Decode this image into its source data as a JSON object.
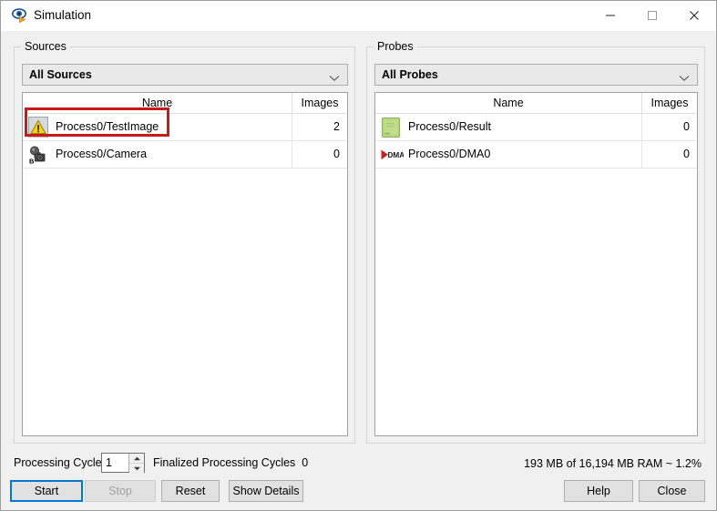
{
  "window": {
    "title": "Simulation",
    "icon": "eye-play-icon",
    "controls": {
      "minimize": "minimize-icon",
      "maximize": "maximize-icon",
      "close": "close-icon"
    }
  },
  "sources": {
    "group_label": "Sources",
    "filter_selected": "All Sources",
    "filter_options": [
      "All Sources"
    ],
    "columns": [
      "Name",
      "Images"
    ],
    "rows": [
      {
        "icon": "warning-triangle-icon",
        "name": "Process0/TestImage",
        "images": "2",
        "highlighted": true
      },
      {
        "icon": "camera-icon",
        "name": "Process0/Camera",
        "images": "0",
        "highlighted": false
      }
    ]
  },
  "probes": {
    "group_label": "Probes",
    "filter_selected": "All Probes",
    "filter_options": [
      "All Probes"
    ],
    "columns": [
      "Name",
      "Images"
    ],
    "rows": [
      {
        "icon": "green-image-icon",
        "name": "Process0/Result",
        "images": "0",
        "highlighted": false
      },
      {
        "icon": "dma-icon",
        "name": "Process0/DMA0",
        "images": "0",
        "highlighted": false
      }
    ]
  },
  "footer": {
    "processing_cycle_label": "Processing Cycle",
    "processing_cycle_value": "1",
    "finalized_label": "Finalized Processing Cycles",
    "finalized_value": "0",
    "ram_status": "193 MB of 16,194 MB RAM ~ 1.2%",
    "buttons": {
      "start": "Start",
      "stop": "Stop",
      "reset": "Reset",
      "show_details": "Show Details",
      "help": "Help",
      "close": "Close"
    }
  },
  "colors": {
    "accent": "#0078d7",
    "highlight": "#c91a1a",
    "warning": "#f2c11c",
    "probe_green": "#a8cf6e",
    "dma_red": "#cc2020"
  }
}
